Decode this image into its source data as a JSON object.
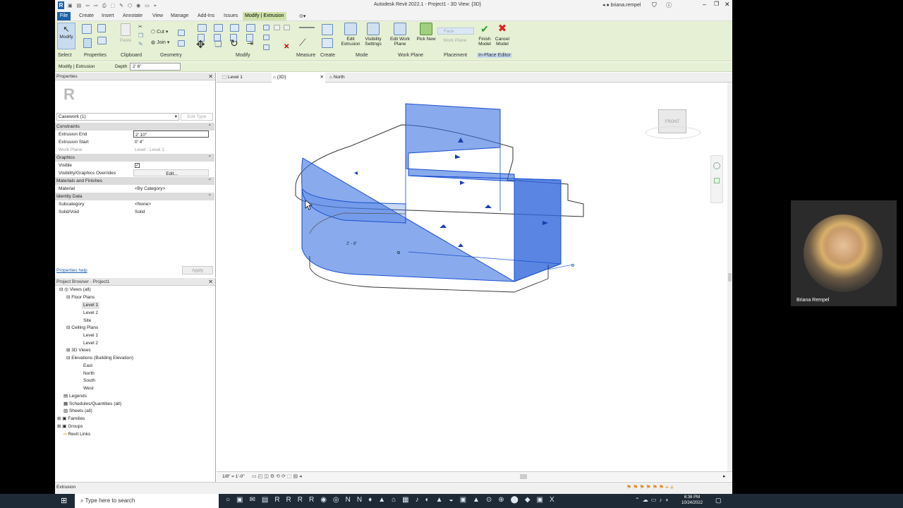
{
  "titlebar": {
    "title": "Autodesk Revit 2022.1 - Project1 - 3D View: {3D}",
    "user": "briana.rempel"
  },
  "tabs": [
    "File",
    "Create",
    "Insert",
    "Annotate",
    "View",
    "Manage",
    "Add-Ins",
    "Issues",
    "Modify | Extrusion"
  ],
  "ribbon": {
    "modify_label": "Modify",
    "cut_label": "Cut",
    "join_label": "Join",
    "paste_label": "Paste",
    "panels": [
      "Select",
      "Properties",
      "Clipboard",
      "Geometry",
      "Modify",
      "Measure",
      "Create",
      "Mode",
      "Work Plane",
      "Placement",
      "In-Place Editor"
    ],
    "buttons": {
      "edit_extrusion": "Edit Extrusion",
      "visibility_settings": "Visibility Settings",
      "edit_work_plane": "Edit Work Plane",
      "pick_new": "Pick New",
      "face": "Face",
      "work_plane": "Work Plane",
      "finish_model": "Finish Model",
      "cancel_model": "Cancel Model"
    }
  },
  "optionsbar": {
    "context": "Modify | Extrusion",
    "depth_label": "Depth",
    "depth_value": "2'  6\""
  },
  "properties": {
    "title": "Properties",
    "type_selector": "Casework (1)",
    "edit_type": "Edit Type",
    "help": "Properties help",
    "apply": "Apply",
    "groups": [
      {
        "name": "Constraints",
        "rows": [
          [
            "Extrusion End",
            "2'  10\""
          ],
          [
            "Extrusion Start",
            "0'  4\""
          ],
          [
            "Work Plane",
            "Level : Level 1"
          ]
        ]
      },
      {
        "name": "Graphics",
        "rows": [
          [
            "Visible",
            ""
          ],
          [
            "Visibility/Graphics Overrides",
            "Edit..."
          ]
        ]
      },
      {
        "name": "Materials and Finishes",
        "rows": [
          [
            "Material",
            "<By Category>"
          ]
        ]
      },
      {
        "name": "Identity Data",
        "rows": [
          [
            "Subcategory",
            "<None>"
          ],
          [
            "Solid/Void",
            "Solid"
          ]
        ]
      }
    ]
  },
  "browser": {
    "title": "Project Browser - Project1",
    "items": [
      "Views (all)",
      "Floor Plans",
      "Level 1",
      "Level 2",
      "Site",
      "Ceiling Plans",
      "Level 1",
      "Level 2",
      "3D Views",
      "Elevations (Building Elevation)",
      "East",
      "North",
      "South",
      "West",
      "Legends",
      "Schedules/Quantities (all)",
      "Sheets (all)",
      "Families",
      "Groups",
      "Revit Links"
    ]
  },
  "viewtabs": [
    "Level 1",
    "{3D}",
    "North"
  ],
  "viewcube": {
    "face": "FRONT"
  },
  "dimension": "2' - 6\"",
  "viewctl": {
    "scale": "1/8\" = 1'-0\""
  },
  "status": "Extrusion",
  "taskbar": {
    "search": "Type here to search",
    "time": "6:36 PM",
    "date": "10/24/2022"
  },
  "webcam": {
    "name": "Briana Rempel"
  }
}
